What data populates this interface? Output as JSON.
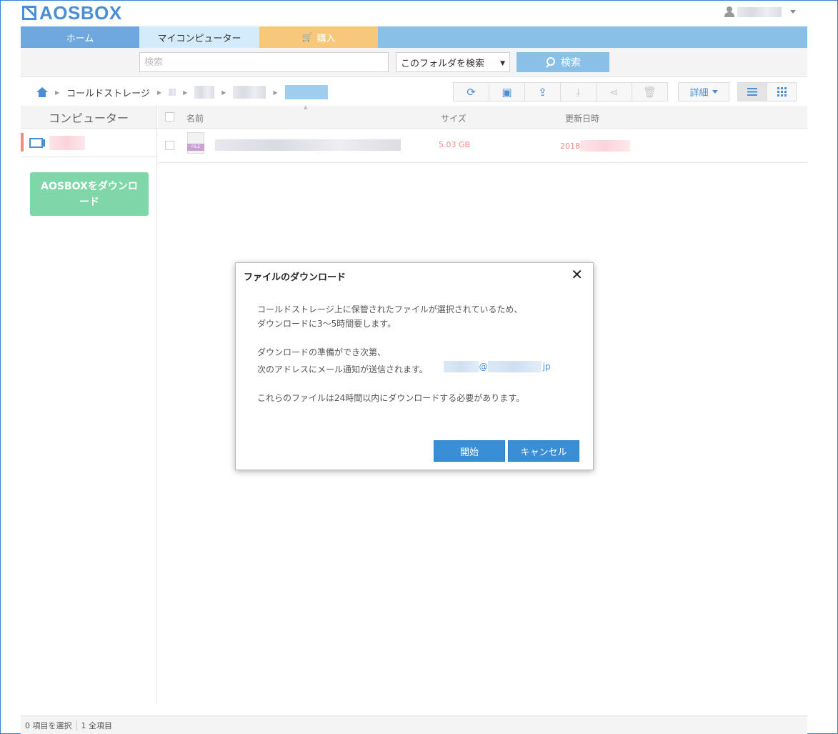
{
  "header": {
    "logo_text": "AOSBOX"
  },
  "nav": {
    "tabs": [
      {
        "label": "ホーム"
      },
      {
        "label": "マイコンピューター"
      },
      {
        "label": "購入"
      }
    ]
  },
  "search": {
    "placeholder": "検索",
    "scope": "このフォルダを検索",
    "button_label": "検索"
  },
  "breadcrumb": {
    "items": [
      "コールドストレージ"
    ]
  },
  "toolbar": {
    "detail_label": "詳細",
    "icons": [
      "refresh-icon",
      "new-folder-icon",
      "upload-icon",
      "download-icon",
      "share-icon",
      "trash-icon",
      "list-view-icon",
      "grid-view-icon"
    ]
  },
  "sidebar": {
    "heading": "コンピューター",
    "download_button": "AOSBOXをダウンロード"
  },
  "file_list": {
    "columns": {
      "name": "名前",
      "size": "サイズ",
      "date": "更新日時"
    },
    "rows": [
      {
        "icon_label": "FILE",
        "size": "5.03 GB",
        "date": "2018"
      }
    ]
  },
  "status": {
    "selected": "0 項目を選択",
    "total": "1 全項目"
  },
  "modal": {
    "title": "ファイルのダウンロード",
    "close": "✕",
    "line1": "コールドストレージ上に保管されたファイルが選択されているため、",
    "line2": "ダウンロードに3〜5時間要します。",
    "line3": "ダウンロードの準備ができ次第、",
    "line4": "次のアドレスにメール通知が送信されます。",
    "email_at": "@",
    "email_tld": "jp",
    "line5": "これらのファイルは24時間以内にダウンロードする必要があります。",
    "start_button": "開始",
    "cancel_button": "キャンセル"
  },
  "colors": {
    "accent": "#4a8fd6",
    "nav_bar": "#8ac0e8",
    "buy_tab": "#f7c77a",
    "download_button": "#7fd6a8",
    "file_meta": "#f08a8a"
  }
}
